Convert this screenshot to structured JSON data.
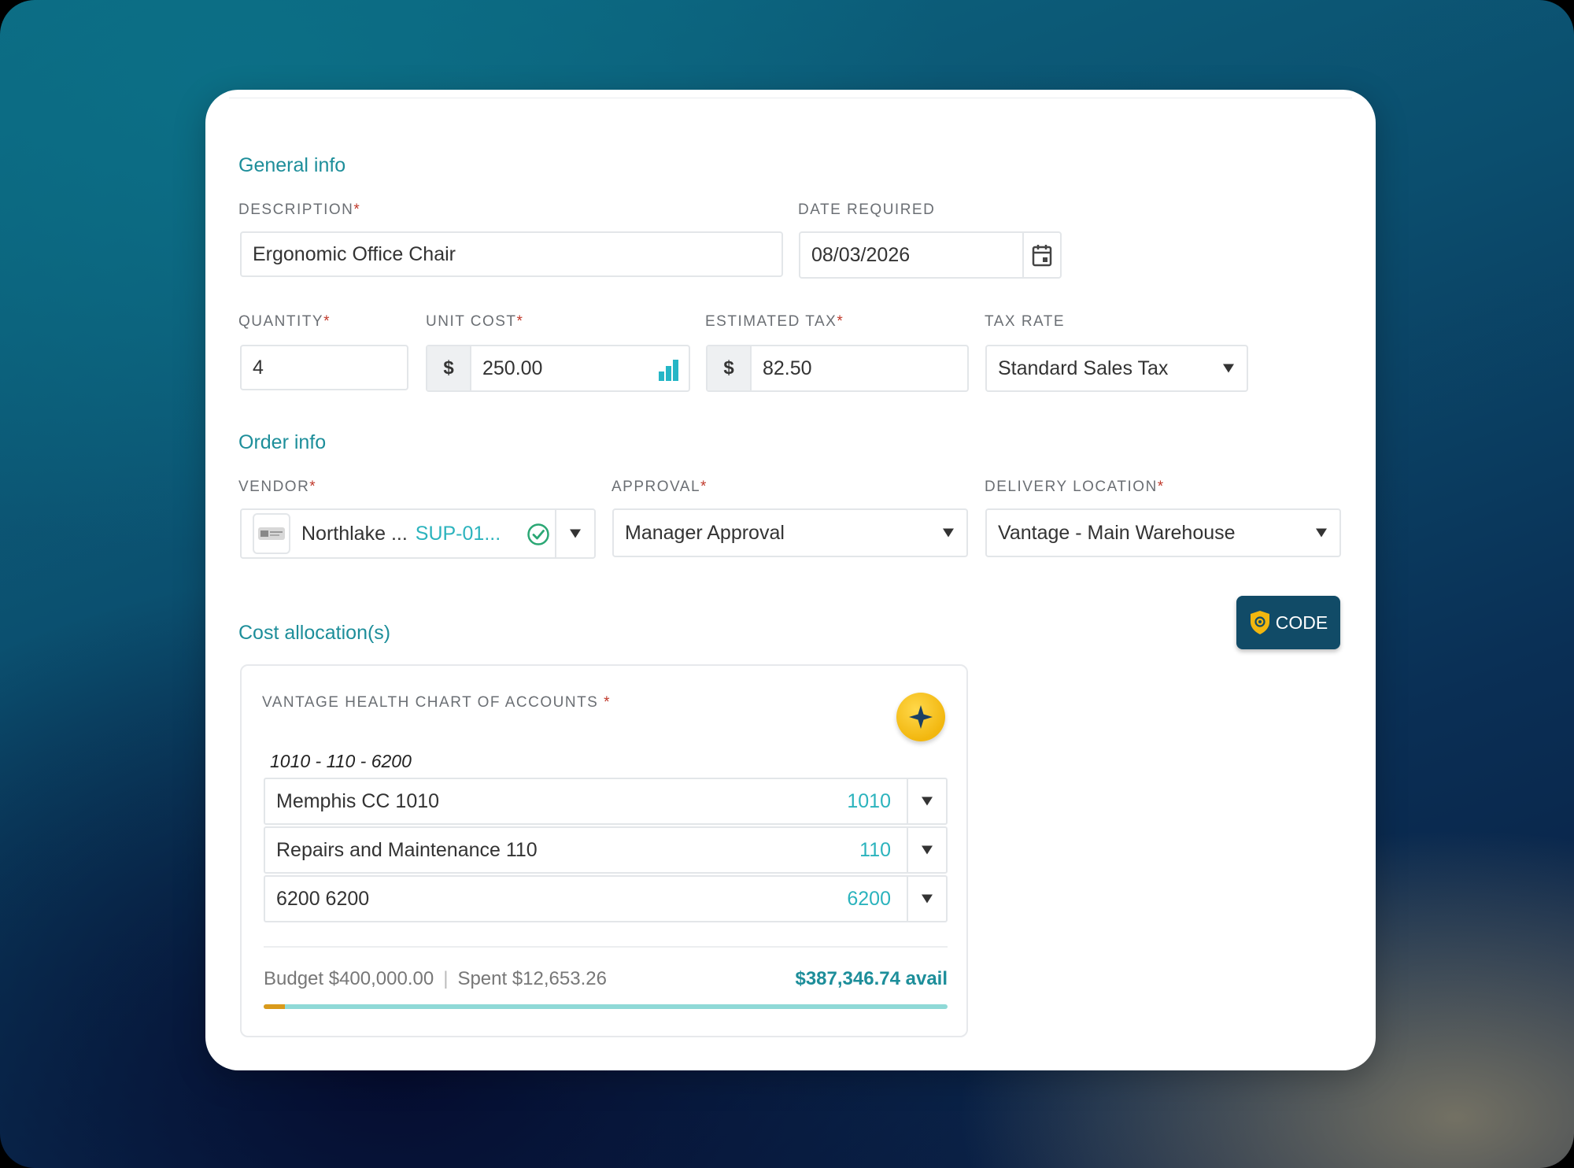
{
  "general": {
    "title": "General info",
    "description_label": "DESCRIPTION",
    "description_value": "Ergonomic Office Chair",
    "date_label": "DATE REQUIRED",
    "date_value": "08/03/2026",
    "quantity_label": "QUANTITY",
    "quantity_value": "4",
    "unit_cost_label": "UNIT COST",
    "unit_cost_prefix": "$",
    "unit_cost_value": "250.00",
    "tax_label": "ESTIMATED TAX",
    "tax_prefix": "$",
    "tax_value": "82.50",
    "tax_rate_label": "TAX RATE",
    "tax_rate_value": "Standard Sales Tax"
  },
  "order": {
    "title": "Order info",
    "vendor_label": "VENDOR",
    "vendor_name": "Northlake ...",
    "vendor_code": "SUP-01...",
    "approval_label": "APPROVAL",
    "approval_value": "Manager Approval",
    "delivery_label": "DELIVERY LOCATION",
    "delivery_value": "Vantage - Main Warehouse"
  },
  "code_button": {
    "label": "CODE"
  },
  "allocation": {
    "title": "Cost allocation(s)",
    "chart_label": "VANTAGE HEALTH CHART OF ACCOUNTS",
    "code_path": "1010 - 110 - 6200",
    "segments": [
      {
        "name": "Memphis CC 1010",
        "code": "1010"
      },
      {
        "name": "Repairs and Maintenance 110",
        "code": "110"
      },
      {
        "name": "6200 6200",
        "code": "6200"
      }
    ],
    "budget": "Budget $400,000.00",
    "spent": "Spent $12,653.26",
    "available": "$387,346.74 avail",
    "spent_fraction": 0.0316
  },
  "required_marker": "*",
  "colors": {
    "accent": "#1d8e9a",
    "code_button": "#114b67",
    "ai_button": "#f2b70f",
    "required": "#c0392b"
  }
}
